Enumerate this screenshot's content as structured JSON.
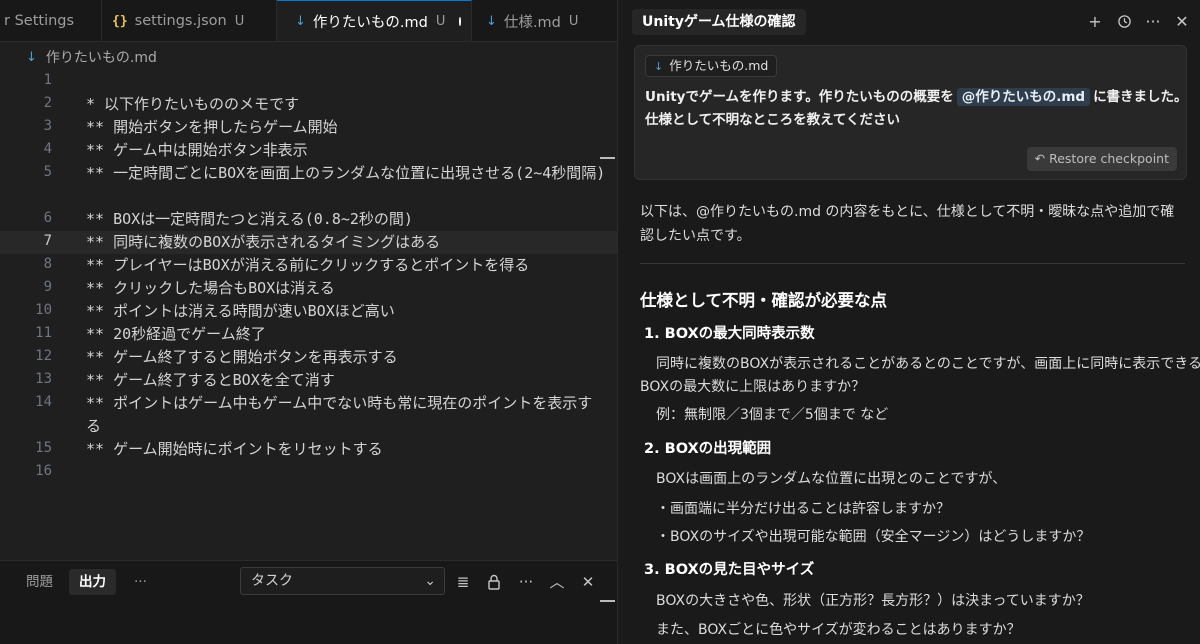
{
  "editor": {
    "tabs": [
      {
        "label": "r Settings",
        "icon": "",
        "badge": ""
      },
      {
        "label": "settings.json",
        "icon": "{}",
        "badge": "U"
      },
      {
        "label": "作りたいもの.md",
        "icon": "↓",
        "badge": "U"
      },
      {
        "label": "仕様.md",
        "icon": "↓",
        "badge": "U"
      }
    ],
    "breadcrumb": "作りたいもの.md",
    "lines": [
      {
        "n": "1",
        "text": ""
      },
      {
        "n": "2",
        "text": "* 以下作りたいもののメモです"
      },
      {
        "n": "3",
        "text": "** 開始ボタンを押したらゲーム開始"
      },
      {
        "n": "4",
        "text": "** ゲーム中は開始ボタン非表示"
      },
      {
        "n": "5",
        "text": "** 一定時間ごとにBOXを画面上のランダムな位置に出現させる(2~4秒間隔)"
      },
      {
        "n": "6",
        "text": "** BOXは一定時間たつと消える(0.8~2秒の間)"
      },
      {
        "n": "7",
        "text": "** 同時に複数のBOXが表示されるタイミングはある"
      },
      {
        "n": "8",
        "text": "** プレイヤーはBOXが消える前にクリックするとポイントを得る"
      },
      {
        "n": "9",
        "text": "** クリックした場合もBOXは消える"
      },
      {
        "n": "10",
        "text": "** ポイントは消える時間が速いBOXほど高い"
      },
      {
        "n": "11",
        "text": "** 20秒経過でゲーム終了"
      },
      {
        "n": "12",
        "text": "** ゲーム終了すると開始ボタンを再表示する"
      },
      {
        "n": "13",
        "text": "** ゲーム終了するとBOXを全て消す"
      },
      {
        "n": "14",
        "text": "** ポイントはゲーム中もゲーム中でない時も常に現在のポイントを表示する"
      },
      {
        "n": "15",
        "text": "** ゲーム開始時にポイントをリセットする"
      },
      {
        "n": "16",
        "text": ""
      }
    ]
  },
  "panel": {
    "tab_problems": "問題",
    "tab_output": "出力",
    "more": "···",
    "task_select": "タスク"
  },
  "chat": {
    "title": "Unityゲーム仕様の確認",
    "user": {
      "chip": "作りたいもの.md",
      "line1_pre": "Unityでゲームを作ります。作りたいものの概要を",
      "mention": "@作りたいもの.md",
      "line1_post": "に書きました。",
      "line2": "仕様として不明なところを教えてください",
      "restore": "Restore checkpoint"
    },
    "reply": {
      "intro": "以下は、@作りたいもの.md の内容をもとに、仕様として不明・曖昧な点や追加で確認したい点です。",
      "heading": "仕様として不明・確認が必要な点",
      "s1_title": "1. BOXの最大同時表示数",
      "s1_l1": "同時に複数のBOXが表示されることがあるとのことですが、画面上に同時に表示できる",
      "s1_l2": "BOXの最大数に上限はありますか？",
      "s1_l3": "例：無制限／3個まで／5個まで など",
      "s2_title": "2. BOXの出現範囲",
      "s2_l1": "BOXは画面上のランダムな位置に出現とのことですが、",
      "s2_l2": "・画面端に半分だけ出ることは許容しますか？",
      "s2_l3": "・BOXのサイズや出現可能な範囲（安全マージン）はどうしますか？",
      "s3_title": "3. BOXの見た目やサイズ",
      "s3_l1": "BOXの大きさや色、形状（正方形？長方形？）は決まっていますか？",
      "s3_l2": "また、BOXごとに色やサイズが変わることはありますか？"
    }
  }
}
